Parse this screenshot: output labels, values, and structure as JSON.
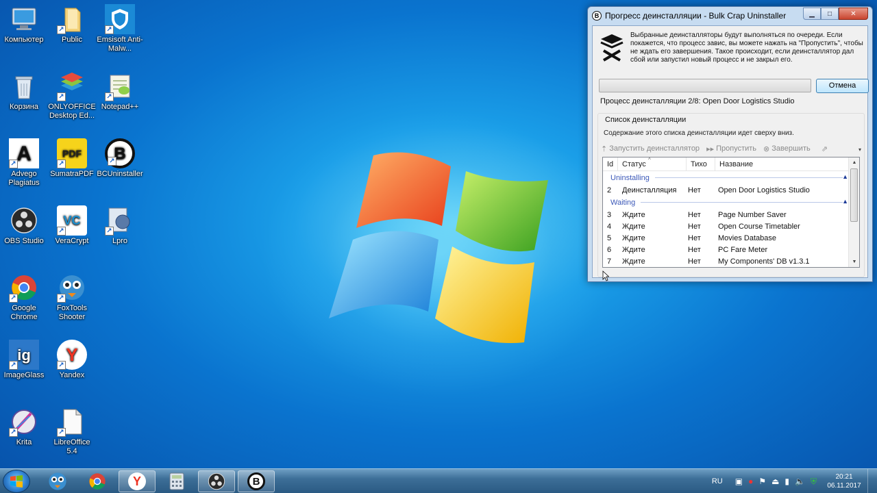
{
  "desktop": {
    "icons": [
      {
        "label": "Компьютер",
        "icon": "computer-icon"
      },
      {
        "label": "Public",
        "icon": "folder-icon"
      },
      {
        "label": "Emsisoft Anti-Malw...",
        "icon": "emsisoft-shield-icon"
      },
      {
        "label": "Корзина",
        "icon": "recycle-bin-icon"
      },
      {
        "label": "ONLYOFFICE Desktop Ed...",
        "icon": "onlyoffice-icon"
      },
      {
        "label": "Notepad++",
        "icon": "notepadpp-icon"
      },
      {
        "label": "Advego Plagiatus",
        "icon": "advego-icon",
        "glyph": "A"
      },
      {
        "label": "SumatraPDF",
        "icon": "sumatrapdf-icon",
        "glyph": "PDF"
      },
      {
        "label": "BCUninstaller",
        "icon": "bcuninstaller-icon",
        "glyph": "B"
      },
      {
        "label": "OBS Studio",
        "icon": "obs-icon"
      },
      {
        "label": "VeraCrypt",
        "icon": "veracrypt-icon",
        "glyph": "VC"
      },
      {
        "label": "Lpro",
        "icon": "lpro-icon"
      },
      {
        "label": "Google Chrome",
        "icon": "chrome-icon"
      },
      {
        "label": "FoxTools Shooter",
        "icon": "foxtools-icon"
      },
      {
        "label": "ImageGlass",
        "icon": "imageglass-icon",
        "glyph": "ig"
      },
      {
        "label": "Yandex",
        "icon": "yandex-icon",
        "glyph": "Y"
      },
      {
        "label": "Krita",
        "icon": "krita-icon"
      },
      {
        "label": "LibreOffice 5.4",
        "icon": "libreoffice-icon"
      }
    ]
  },
  "window": {
    "title": "Прогресс деинсталляции - Bulk Crap Uninstaller",
    "title_glyph": "B",
    "info_text": "Выбранные деинсталляторы будут выполняться по очереди. Если покажется, что процесс завис, вы можете нажать на \"Пропустить\", чтобы не ждать его завершения. Такое происходит, если деинсталлятор дал сбой или запустил новый процесс и не закрыл его.",
    "progress_value": 0.0,
    "cancel_label": "Отмена",
    "status_text": "Процесс деинсталляции 2/8: Open Door Logistics Studio",
    "group_title": "Список деинсталляции",
    "group_desc": "Содержание этого списка деинсталляции идет сверху вниз.",
    "toolbar": {
      "run": "Запустить деинсталлятор",
      "skip": "Пропустить",
      "finish": "Завершить"
    },
    "columns": {
      "id": "Id",
      "status": "Статус",
      "quiet": "Тихо",
      "name": "Название"
    },
    "groups": [
      {
        "label": "Uninstalling",
        "rows": [
          {
            "id": "2",
            "status": "Деинсталляция",
            "quiet": "Нет",
            "name": "Open Door Logistics Studio"
          }
        ]
      },
      {
        "label": "Waiting",
        "rows": [
          {
            "id": "3",
            "status": "Ждите",
            "quiet": "Нет",
            "name": "Page Number Saver"
          },
          {
            "id": "4",
            "status": "Ждите",
            "quiet": "Нет",
            "name": "Open Course Timetabler"
          },
          {
            "id": "5",
            "status": "Ждите",
            "quiet": "Нет",
            "name": "Movies Database"
          },
          {
            "id": "6",
            "status": "Ждите",
            "quiet": "Нет",
            "name": "PC Fare Meter"
          },
          {
            "id": "7",
            "status": "Ждите",
            "quiet": "Нет",
            "name": "My Components' DB v1.3.1"
          }
        ]
      }
    ]
  },
  "taskbar": {
    "lang": "RU",
    "time": "20:21",
    "date": "06.11.2017"
  }
}
